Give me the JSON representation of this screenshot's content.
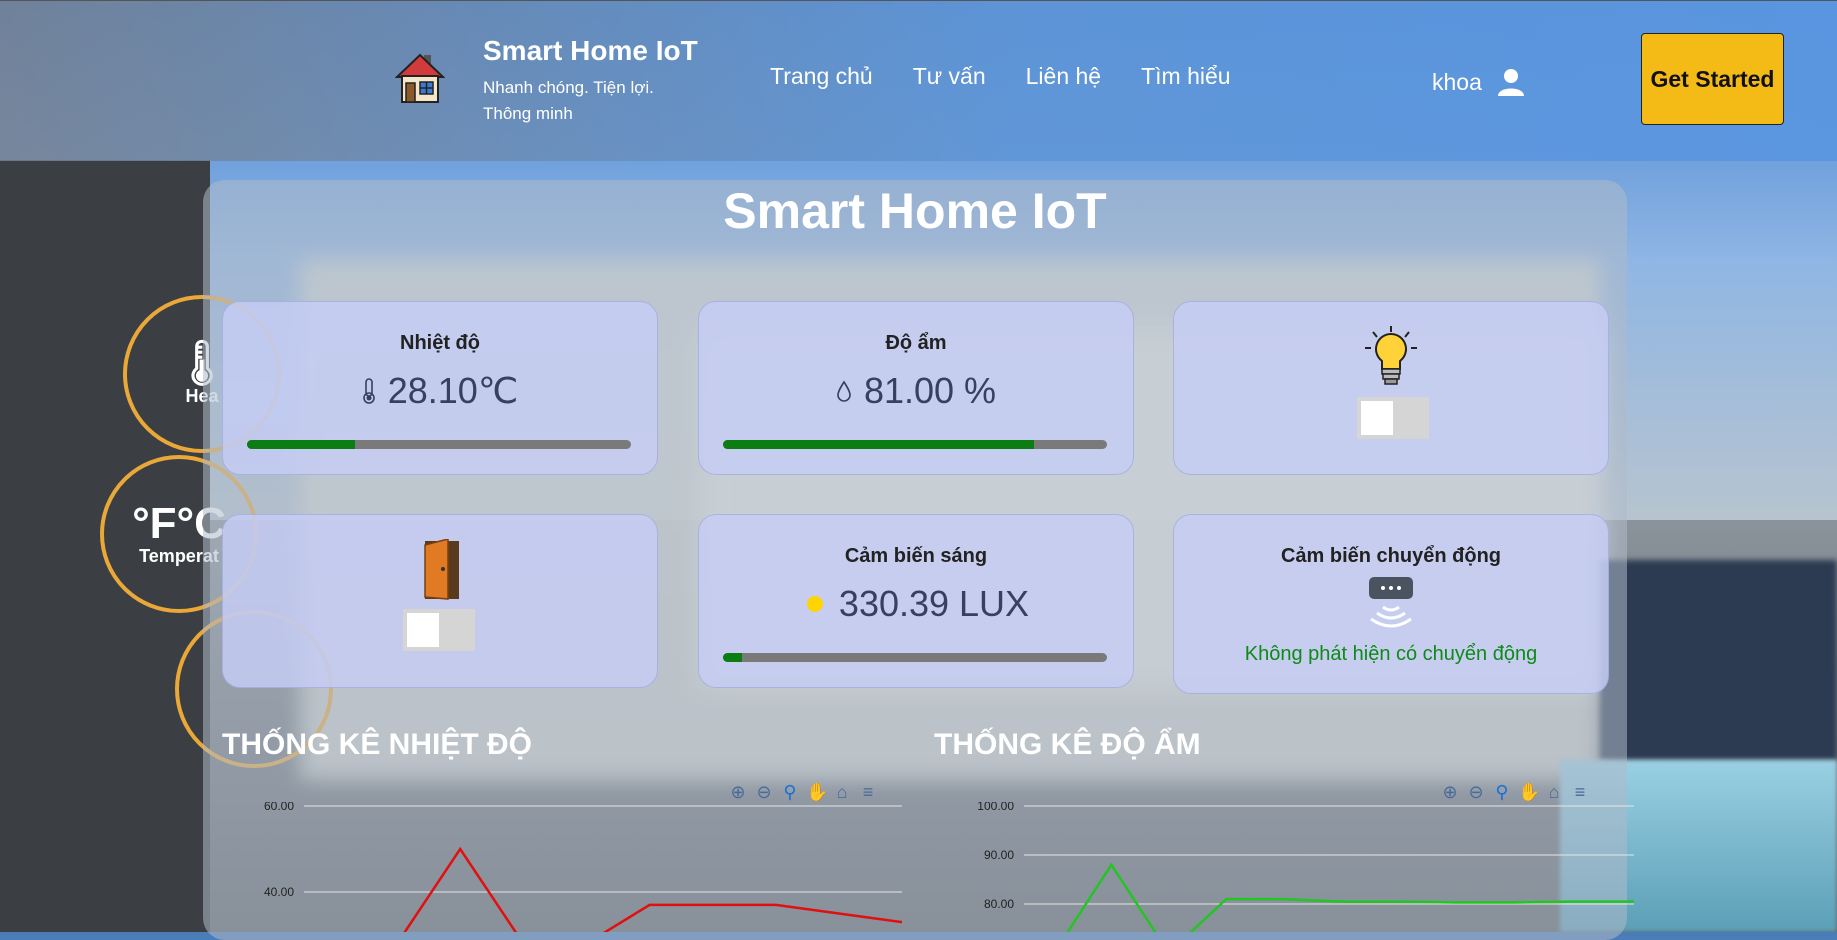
{
  "header": {
    "brand_title": "Smart Home IoT",
    "brand_tagline": "Nhanh chóng. Tiện lợi. Thông minh",
    "nav": [
      "Trang chủ",
      "Tư vấn",
      "Liên hệ",
      "Tìm hiểu"
    ],
    "username": "khoa",
    "cta_label": "Get Started"
  },
  "background_rings": [
    {
      "big": "",
      "small": "Hea"
    },
    {
      "big": "°F°C",
      "small": "Temperat"
    }
  ],
  "panel": {
    "title": "Smart Home IoT",
    "temperature": {
      "label": "Nhiệt độ",
      "value": "28.10℃",
      "progress": 0.28
    },
    "humidity": {
      "label": "Độ ẩm",
      "value": "81.00 %",
      "progress": 0.81
    },
    "light_switch": {
      "state": "off"
    },
    "door_switch": {
      "state": "off"
    },
    "light_sensor": {
      "label": "Cảm biến sáng",
      "value": "330.39 LUX",
      "progress": 0.05
    },
    "motion_sensor": {
      "label": "Cảm biến chuyển động",
      "status": "Không phát hiện có chuyển động"
    }
  },
  "charts": {
    "temperature_title": "THỐNG KÊ NHIỆT ĐỘ",
    "humidity_title": "THỐNG KÊ ĐỘ ẨM",
    "toolbar_icons": [
      "zoom-in-icon",
      "zoom-out-icon",
      "zoom-select-icon",
      "pan-icon",
      "reset-home-icon",
      "menu-icon"
    ]
  },
  "chart_data": [
    {
      "type": "line",
      "ylim": [
        20,
        60
      ],
      "yticks": [
        "60.00",
        "40.00"
      ],
      "series": [
        {
          "color": "#e01010",
          "values": [
            29,
            28,
            50,
            28,
            28,
            37,
            37,
            37,
            35,
            33
          ]
        }
      ]
    },
    {
      "type": "line",
      "ylim": [
        70,
        100
      ],
      "yticks": [
        "100.00",
        "90.00",
        "80.00"
      ],
      "series": [
        {
          "color": "#22c522",
          "values": [
            70,
            88,
            70,
            81,
            81,
            80.5,
            80.5,
            80.3,
            80.3,
            80.5,
            80.5,
            81,
            81,
            81
          ]
        }
      ]
    }
  ],
  "colors": {
    "accent": "#f4bb16",
    "progress": "#0b7d12",
    "motion_ok": "#0e8a16"
  }
}
